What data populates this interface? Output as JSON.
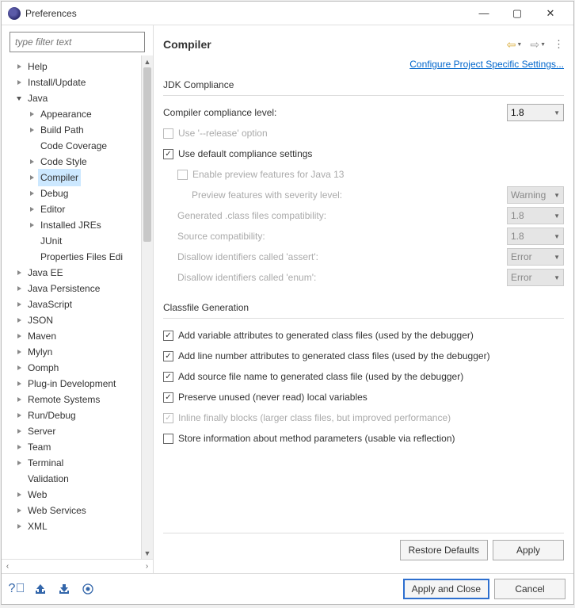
{
  "window": {
    "title": "Preferences"
  },
  "sidebar": {
    "filter_placeholder": "type filter text",
    "items": [
      {
        "label": "Help"
      },
      {
        "label": "Install/Update"
      },
      {
        "label": "Java",
        "expanded": true,
        "children": [
          {
            "label": "Appearance"
          },
          {
            "label": "Build Path"
          },
          {
            "label": "Code Coverage",
            "noTwisty": true
          },
          {
            "label": "Code Style"
          },
          {
            "label": "Compiler",
            "selected": true
          },
          {
            "label": "Debug"
          },
          {
            "label": "Editor"
          },
          {
            "label": "Installed JREs"
          },
          {
            "label": "JUnit",
            "noTwisty": true
          },
          {
            "label": "Properties Files Edi",
            "noTwisty": true
          }
        ]
      },
      {
        "label": "Java EE"
      },
      {
        "label": "Java Persistence"
      },
      {
        "label": "JavaScript"
      },
      {
        "label": "JSON"
      },
      {
        "label": "Maven"
      },
      {
        "label": "Mylyn"
      },
      {
        "label": "Oomph"
      },
      {
        "label": "Plug-in Development"
      },
      {
        "label": "Remote Systems"
      },
      {
        "label": "Run/Debug"
      },
      {
        "label": "Server"
      },
      {
        "label": "Team"
      },
      {
        "label": "Terminal"
      },
      {
        "label": "Validation",
        "noTwisty": true
      },
      {
        "label": "Web"
      },
      {
        "label": "Web Services"
      },
      {
        "label": "XML"
      }
    ]
  },
  "main": {
    "title": "Compiler",
    "config_link": "Configure Project Specific Settings...",
    "jdk": {
      "group_title": "JDK Compliance",
      "compliance_label": "Compiler compliance level:",
      "compliance_value": "1.8",
      "use_release_label": "Use '--release' option",
      "use_default_label": "Use default compliance settings",
      "enable_preview_label": "Enable preview features for Java 13",
      "preview_severity_label": "Preview features with severity level:",
      "preview_severity_value": "Warning",
      "generated_class_label": "Generated .class files compatibility:",
      "generated_class_value": "1.8",
      "source_compat_label": "Source compatibility:",
      "source_compat_value": "1.8",
      "disallow_assert_label": "Disallow identifiers called 'assert':",
      "disallow_assert_value": "Error",
      "disallow_enum_label": "Disallow identifiers called 'enum':",
      "disallow_enum_value": "Error"
    },
    "classfile": {
      "group_title": "Classfile Generation",
      "add_var_label": "Add variable attributes to generated class files (used by the debugger)",
      "add_line_label": "Add line number attributes to generated class files (used by the debugger)",
      "add_source_label": "Add source file name to generated class file (used by the debugger)",
      "preserve_label": "Preserve unused (never read) local variables",
      "inline_label": "Inline finally blocks (larger class files, but improved performance)",
      "store_label": "Store information about method parameters (usable via reflection)"
    },
    "restore_defaults": "Restore Defaults",
    "apply": "Apply"
  },
  "footer": {
    "apply_close": "Apply and Close",
    "cancel": "Cancel"
  }
}
